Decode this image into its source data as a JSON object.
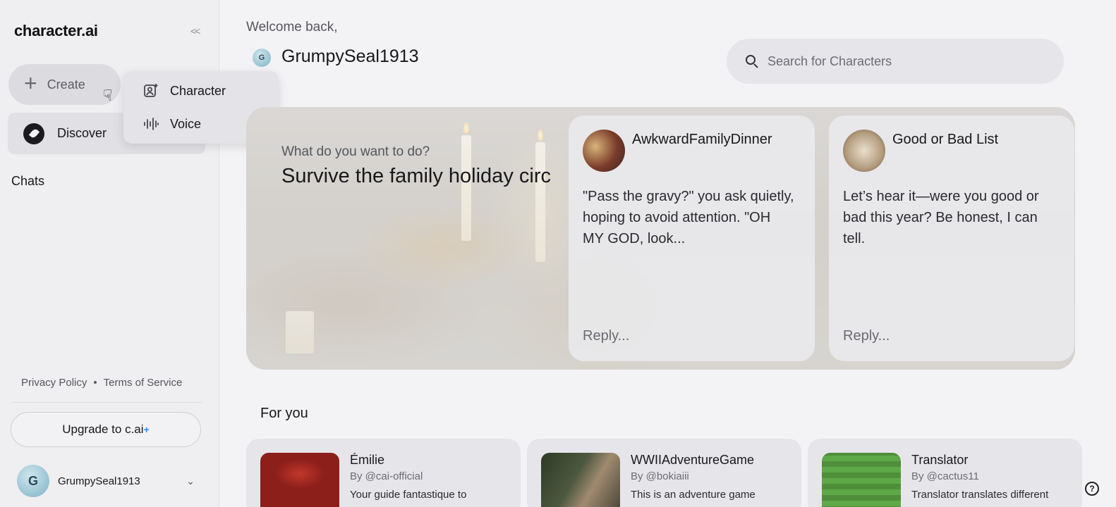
{
  "sidebar": {
    "logo": "character.ai",
    "collapse_icon": "chevrons-left-icon",
    "create_label": "Create",
    "discover_label": "Discover",
    "chats_label": "Chats",
    "privacy": "Privacy Policy",
    "separator": "•",
    "terms": "Terms of Service",
    "upgrade_label": "Upgrade to c.ai",
    "upgrade_plus": "+",
    "user": {
      "initial": "G",
      "name": "GrumpySeal1913"
    }
  },
  "create_menu": {
    "items": [
      {
        "label": "Character",
        "icon": "character-add-icon"
      },
      {
        "label": "Voice",
        "icon": "voice-waveform-icon"
      }
    ]
  },
  "header": {
    "welcome": "Welcome back,",
    "avatar_initial": "G",
    "username": "GrumpySeal1913"
  },
  "search": {
    "placeholder": "Search for Characters"
  },
  "hero": {
    "question": "What do you want to do?",
    "title": "Survive the family holiday circ",
    "cards": [
      {
        "name": "AwkwardFamilyDinner",
        "text": "\"Pass the gravy?\" you ask quietly, hoping to avoid attention. \"OH MY GOD, look...",
        "reply_placeholder": "Reply..."
      },
      {
        "name": "Good or Bad List",
        "text": "Let’s hear it—were you good or bad this year? Be honest, I can tell.",
        "reply_placeholder": "Reply..."
      }
    ]
  },
  "for_you": {
    "heading": "For you",
    "cards": [
      {
        "title": "Émilie",
        "by": "By @cai-official",
        "desc": "Your guide fantastique to"
      },
      {
        "title": "WWIIAdventureGame",
        "by": "By @bokiaiii",
        "desc": "This is an adventure game"
      },
      {
        "title": "Translator",
        "by": "By @cactus11",
        "desc": "Translator translates different"
      }
    ]
  },
  "help_label": "?"
}
